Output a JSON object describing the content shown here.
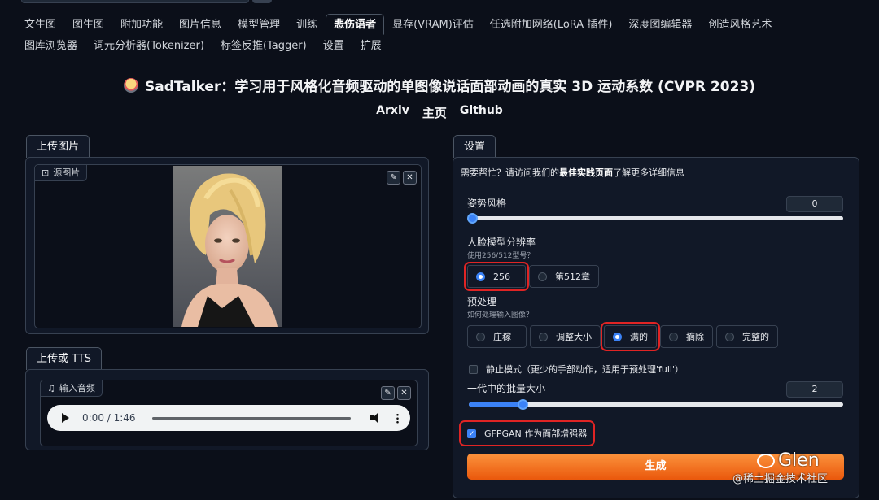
{
  "tabs_row1": [
    "文生图",
    "图生图",
    "附加功能",
    "图片信息",
    "模型管理",
    "训练",
    "悲伤语者",
    "显存(VRAM)评估",
    "任选附加网络(LoRA 插件)",
    "深度图编辑器",
    "创造风格艺术"
  ],
  "tabs_row2": [
    "图库浏览器",
    "词元分析器(Tokenizer)",
    "标签反推(Tagger)",
    "设置",
    "扩展"
  ],
  "active_tab": "悲伤语者",
  "header": {
    "title": "SadTalker：学习用于风格化音频驱动的单图像说话面部动画的真实 3D 运动系数 (CVPR 2023)",
    "links": [
      "Arxiv",
      "主页",
      "Github"
    ]
  },
  "left": {
    "upload_tab": "上传图片",
    "source_label": "源图片",
    "tts_tab": "上传或 TTS",
    "audio_label": "输入音频",
    "audio_time": "0:00 / 1:46",
    "audio_progress": 0
  },
  "settings": {
    "tab": "设置",
    "help_prefix": "需要帮忙？请访问我们的",
    "help_link": "最佳实践页面",
    "help_suffix": "了解更多详细信息",
    "pose_label": "姿势风格",
    "pose_value": "0",
    "pose_fraction": 0,
    "resolution_label": "人脸模型分辨率",
    "resolution_sub": "使用256/512型号？",
    "resolution_options": [
      "256",
      "第512章"
    ],
    "resolution_selected": "256",
    "preprocess_label": "预处理",
    "preprocess_sub": "如何处理输入图像？",
    "preprocess_options": [
      "庄稼",
      "调整大小",
      "满的",
      "摘除",
      "完整的"
    ],
    "preprocess_selected": "满的",
    "still_label": "静止模式（更少的手部动作，适用于预处理'full'）",
    "still_checked": false,
    "batch_label": "一代中的批量大小",
    "batch_value": "2",
    "batch_fraction": 0.143,
    "gfpgan_label": "GFPGAN 作为面部增强器",
    "gfpgan_checked": true,
    "generate_label": "生成"
  },
  "watermark": {
    "logo_text": "Glen",
    "site_text": "@稀土掘金技术社区"
  },
  "colors": {
    "background": "#0b0f19",
    "accent": "#3b82f6",
    "generate": "#f97316",
    "highlight": "#e02424"
  }
}
